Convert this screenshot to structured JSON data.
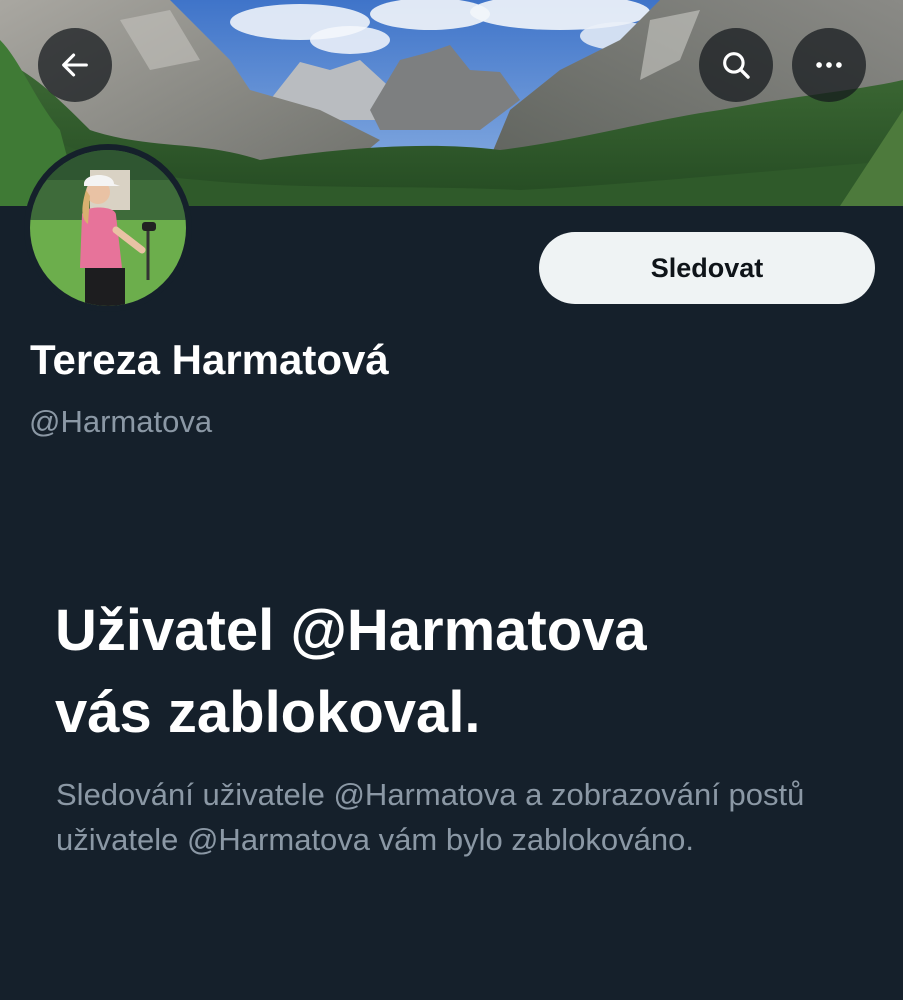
{
  "header": {
    "back_icon": "arrow-left-icon",
    "search_icon": "search-icon",
    "more_icon": "more-horizontal-icon"
  },
  "profile": {
    "display_name": "Tereza Harmatová",
    "handle": "@Harmatova",
    "follow_label": "Sledovat"
  },
  "blocked": {
    "title_line1": "Uživatel @Harmatova",
    "title_line2": "vás zablokoval.",
    "description": "Sledování uživatele @Harmatova a zobrazování postů uživatele @Harmatova vám bylo zablokováno."
  },
  "colors": {
    "background": "#15202b",
    "primary_text": "#ffffff",
    "secondary_text": "#8b98a5",
    "follow_button_bg": "#eff3f4",
    "follow_button_text": "#0f1419"
  }
}
